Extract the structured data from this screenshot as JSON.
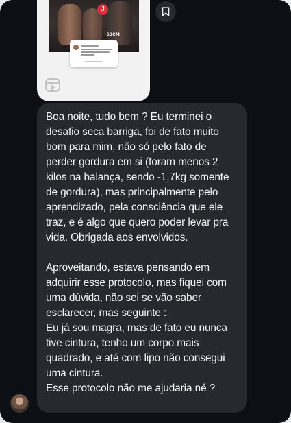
{
  "reel": {
    "thumb_tag": "63CM",
    "logo_glyph": "J"
  },
  "message": {
    "paragraphs": [
      "Boa noite, tudo bem ? Eu terminei o desafio seca barriga, foi de fato muito bom para mim, não só pelo fato de perder gordura em si (foram menos 2 kilos na balança, sendo -1,7kg somente de gordura), mas principalmente pelo aprendizado, pela consciência que ele traz, e é algo que quero poder levar pra vida. Obrigada aos envolvidos.",
      "Aproveitando, estava pensando em adquirir esse protocolo, mas fiquei com uma dúvida, não sei se vão saber esclarecer, mas seguinte :\nEu já sou magra, mas de fato eu nunca tive cintura, tenho um corpo mais quadrado, e até com lipo não consegui uma cintura.\nEsse protocolo não me ajudaria né ?"
    ]
  },
  "colors": {
    "background": "#0c1014",
    "bubble": "#262a2f",
    "text": "#f5f5f5"
  },
  "icons": {
    "save": "bookmark-icon",
    "reels": "reels-icon",
    "avatar": "sender-avatar"
  }
}
